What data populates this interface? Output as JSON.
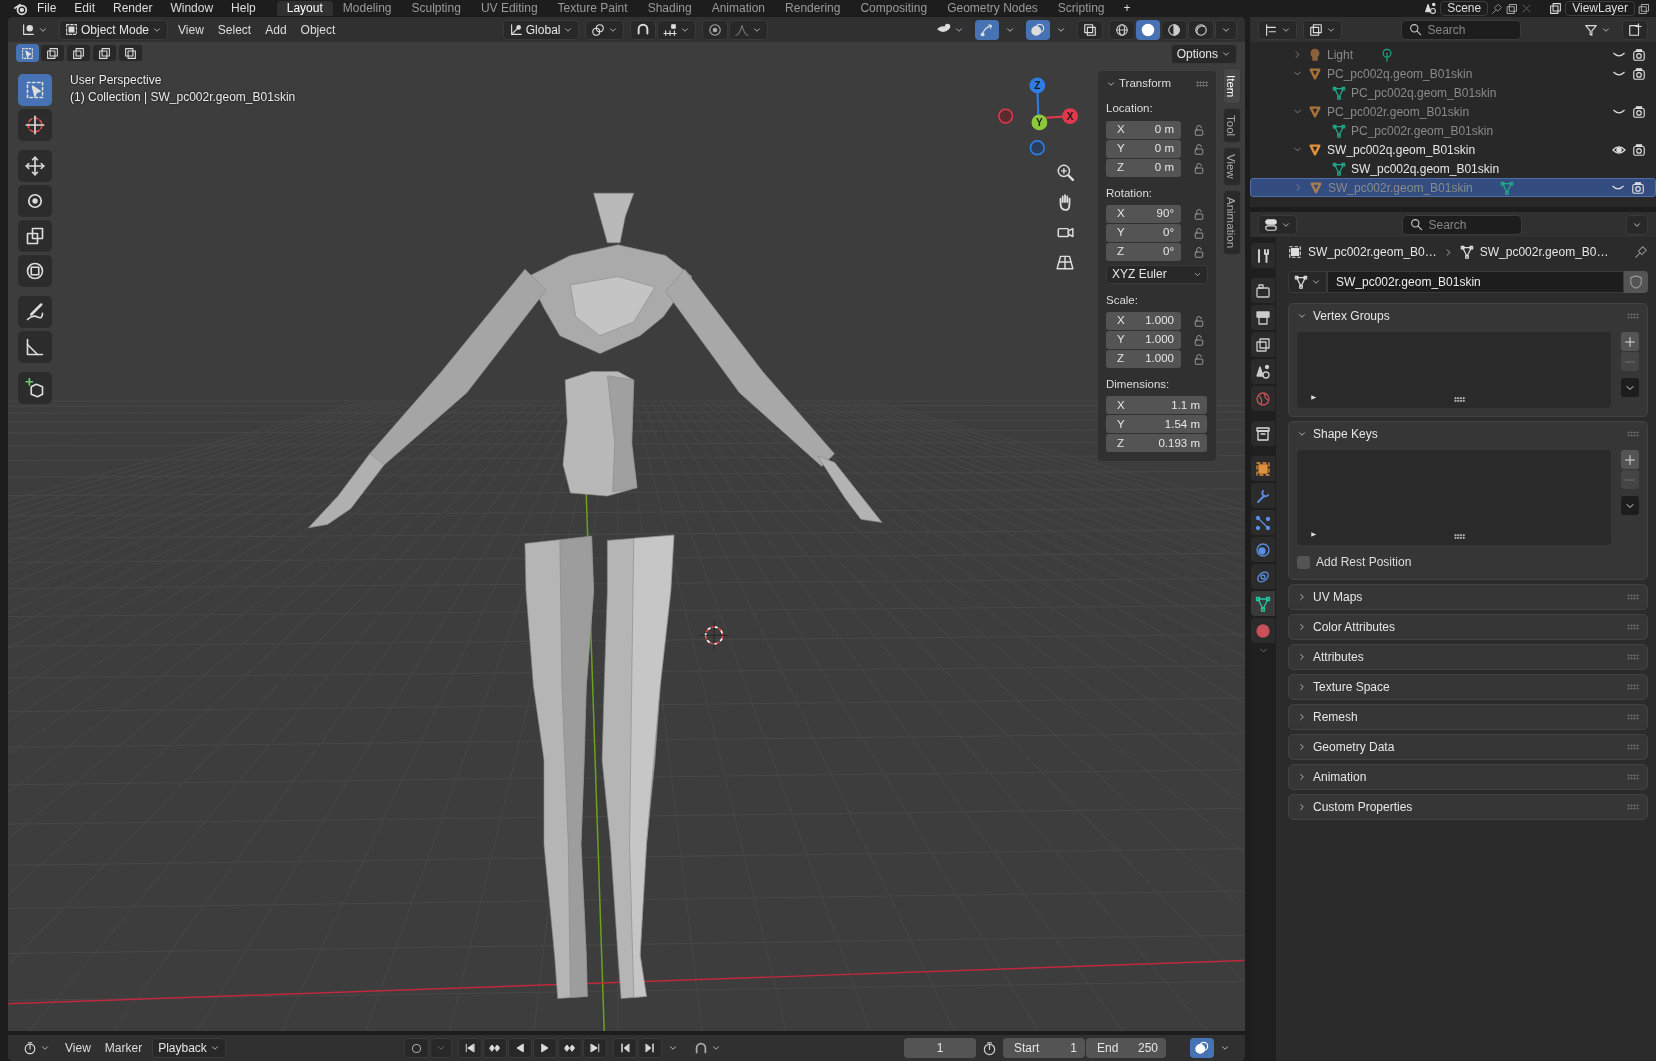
{
  "menus": [
    "File",
    "Edit",
    "Render",
    "Window",
    "Help"
  ],
  "workspaces": [
    {
      "label": "Layout",
      "selected": true
    },
    {
      "label": "Modeling",
      "selected": false
    },
    {
      "label": "Sculpting",
      "selected": false
    },
    {
      "label": "UV Editing",
      "selected": false
    },
    {
      "label": "Texture Paint",
      "selected": false
    },
    {
      "label": "Shading",
      "selected": false
    },
    {
      "label": "Animation",
      "selected": false
    },
    {
      "label": "Rendering",
      "selected": false
    },
    {
      "label": "Compositing",
      "selected": false
    },
    {
      "label": "Geometry Nodes",
      "selected": false
    },
    {
      "label": "Scripting",
      "selected": false
    }
  ],
  "add_workspace": "+",
  "scene": "Scene",
  "view_layer": "ViewLayer",
  "viewport": {
    "mode": "Object Mode",
    "menus": [
      "View",
      "Select",
      "Add",
      "Object"
    ],
    "orientation": "Global",
    "toggles": [
      {
        "kind": "gizmos",
        "on": true
      },
      {
        "kind": "overlays",
        "on": true
      },
      {
        "kind": "xray",
        "on": false
      }
    ],
    "shading": [
      {
        "kind": "wireframe",
        "selected": false
      },
      {
        "kind": "solid",
        "selected": true
      },
      {
        "kind": "material",
        "selected": false
      },
      {
        "kind": "rendered",
        "selected": false
      }
    ],
    "select_modes": [
      {
        "kind": "set",
        "selected": true
      },
      {
        "kind": "extend",
        "selected": false
      },
      {
        "kind": "subtract",
        "selected": false
      },
      {
        "kind": "invert",
        "selected": false
      },
      {
        "kind": "intersect",
        "selected": false
      }
    ],
    "options": "Options",
    "info": [
      "User Perspective",
      "(1) Collection | SW_pc002r.geom_B01skin"
    ],
    "tools": [
      {
        "kind": "select",
        "selected": true
      },
      {
        "kind": "cursor",
        "selected": false
      },
      {
        "kind": "move",
        "selected": false
      },
      {
        "kind": "rotate",
        "selected": false
      },
      {
        "kind": "scale",
        "selected": false
      },
      {
        "kind": "transform",
        "selected": false
      },
      {
        "kind": "annotate",
        "selected": false
      },
      {
        "kind": "measure",
        "selected": false
      },
      {
        "kind": "addcube",
        "selected": false
      }
    ],
    "gizmo": [
      {
        "label": "Z",
        "kind": "z"
      },
      {
        "label": "Y",
        "kind": "y"
      },
      {
        "label": "X",
        "kind": "x"
      }
    ]
  },
  "sidebar": {
    "tabs": [
      {
        "label": "Item",
        "selected": true
      },
      {
        "label": "Tool",
        "selected": false
      },
      {
        "label": "View",
        "selected": false
      },
      {
        "label": "Animation",
        "selected": false
      }
    ],
    "panel": {
      "title": "Transform",
      "expanded": true,
      "groups": [
        {
          "label": "Location:",
          "lockable": true,
          "rows": [
            {
              "axis": "X",
              "value": "0 m"
            },
            {
              "axis": "Y",
              "value": "0 m"
            },
            {
              "axis": "Z",
              "value": "0 m"
            }
          ]
        },
        {
          "label": "Rotation:",
          "lockable": true,
          "rows": [
            {
              "axis": "X",
              "value": "90°"
            },
            {
              "axis": "Y",
              "value": "0°"
            },
            {
              "axis": "Z",
              "value": "0°"
            }
          ],
          "mode": "XYZ Euler"
        },
        {
          "label": "Scale:",
          "lockable": true,
          "rows": [
            {
              "axis": "X",
              "value": "1.000"
            },
            {
              "axis": "Y",
              "value": "1.000"
            },
            {
              "axis": "Z",
              "value": "1.000"
            }
          ]
        },
        {
          "label": "Dimensions:",
          "lockable": false,
          "rows": [
            {
              "axis": "X",
              "value": "1.1 m"
            },
            {
              "axis": "Y",
              "value": "1.54 m"
            },
            {
              "axis": "Z",
              "value": "0.193 m"
            }
          ]
        }
      ]
    }
  },
  "outliner": {
    "search_placeholder": "Search",
    "rows": [
      {
        "label": "Light",
        "kind": "light",
        "expanded": false,
        "visible": false,
        "selected": false,
        "children": [
          {
            "kind": "light_data"
          }
        ]
      },
      {
        "label": "PC_pc002q.geom_B01skin",
        "kind": "mesh",
        "expanded": true,
        "visible": false,
        "selected": false,
        "children": [
          {
            "kind": "mesh_data",
            "label": "PC_pc002q.geom_B01skin"
          }
        ]
      },
      {
        "label": "PC_pc002r.geom_B01skin",
        "kind": "mesh",
        "expanded": true,
        "visible": false,
        "selected": false,
        "children": [
          {
            "kind": "mesh_data",
            "label": "PC_pc002r.geom_B01skin"
          }
        ]
      },
      {
        "label": "SW_pc002q.geom_B01skin",
        "kind": "mesh",
        "expanded": true,
        "visible": true,
        "selected": false,
        "children": [
          {
            "kind": "mesh_data",
            "label": "SW_pc002q.geom_B01skin"
          }
        ]
      },
      {
        "label": "SW_pc002r.geom_B01skin",
        "kind": "mesh",
        "expanded": false,
        "visible": false,
        "selected": true,
        "children": [
          {
            "kind": "mesh_data"
          }
        ]
      }
    ]
  },
  "properties": {
    "search_placeholder": "Search",
    "tabs": [
      {
        "kind": "tool",
        "selected": false
      },
      {
        "kind": "render",
        "selected": false
      },
      {
        "kind": "output",
        "selected": false
      },
      {
        "kind": "viewlayer",
        "selected": false
      },
      {
        "kind": "scene",
        "selected": false
      },
      {
        "kind": "world",
        "selected": false
      },
      {
        "kind": "collection",
        "selected": false
      },
      {
        "kind": "object",
        "selected": false
      },
      {
        "kind": "modifier",
        "selected": false
      },
      {
        "kind": "particles",
        "selected": false
      },
      {
        "kind": "physics",
        "selected": false
      },
      {
        "kind": "constraints",
        "selected": false
      },
      {
        "kind": "data",
        "selected": true
      },
      {
        "kind": "material",
        "selected": false
      }
    ],
    "breadcrumb": [
      "SW_pc002r.geom_B0…",
      "SW_pc002r.geom_B0…"
    ],
    "datablock": "SW_pc002r.geom_B01skin",
    "panels": [
      {
        "title": "Vertex Groups",
        "expanded": true,
        "kind": "list"
      },
      {
        "title": "Shape Keys",
        "expanded": true,
        "kind": "list",
        "checkbox": {
          "label": "Add Rest Position",
          "checked": false
        }
      },
      {
        "title": "UV Maps",
        "expanded": false
      },
      {
        "title": "Color Attributes",
        "expanded": false
      },
      {
        "title": "Attributes",
        "expanded": false
      },
      {
        "title": "Texture Space",
        "expanded": false
      },
      {
        "title": "Remesh",
        "expanded": false
      },
      {
        "title": "Geometry Data",
        "expanded": false
      },
      {
        "title": "Animation",
        "expanded": false
      },
      {
        "title": "Custom Properties",
        "expanded": false
      }
    ]
  },
  "timeline": {
    "menus": [
      "View",
      "Marker"
    ],
    "playback": "Playback",
    "frame": "1",
    "start_label": "Start",
    "start": "1",
    "end_label": "End",
    "end": "250"
  }
}
